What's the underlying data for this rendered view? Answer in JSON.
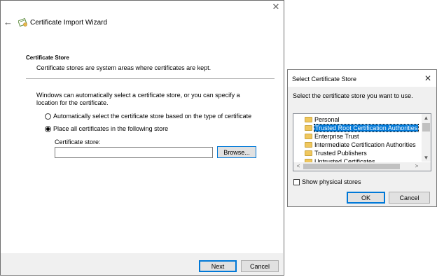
{
  "wizard": {
    "title": "Certificate Import Wizard",
    "close_glyph": "✕",
    "back_glyph": "←",
    "section_heading": "Certificate Store",
    "section_description": "Certificate stores are system areas where certificates are kept.",
    "info_text": "Windows can automatically select a certificate store, or you can specify a location for the certificate.",
    "radio_auto_label": "Automatically select the certificate store based on the type of certificate",
    "radio_manual_label": "Place all certificates in the following store",
    "radio_selected": "manual",
    "store_field_label": "Certificate store:",
    "store_field_value": "",
    "browse_label": "Browse...",
    "next_label": "Next",
    "cancel_label": "Cancel"
  },
  "dialog": {
    "title": "Select Certificate Store",
    "close_glyph": "✕",
    "prompt": "Select the certificate store you want to use.",
    "stores": [
      {
        "label": "Personal",
        "selected": false
      },
      {
        "label": "Trusted Root Certification Authorities",
        "selected": true
      },
      {
        "label": "Enterprise Trust",
        "selected": false
      },
      {
        "label": "Intermediate Certification Authorities",
        "selected": false
      },
      {
        "label": "Trusted Publishers",
        "selected": false
      },
      {
        "label": "Untrusted Certificates",
        "selected": false
      }
    ],
    "scroll_up_glyph": "▲",
    "scroll_down_glyph": "▼",
    "scroll_left_glyph": "<",
    "scroll_right_glyph": ">",
    "show_physical_label": "Show physical stores",
    "show_physical_checked": false,
    "ok_label": "OK",
    "cancel_label": "Cancel"
  },
  "colors": {
    "selection": "#0078d7",
    "folder": "#f0c75e",
    "footer_bg": "#f0f0f0"
  },
  "icons": [
    "back-arrow-icon",
    "certificate-icon",
    "close-icon",
    "folder-icon"
  ]
}
